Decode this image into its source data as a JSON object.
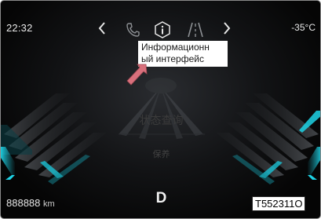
{
  "status_bar": {
    "time": "22:32",
    "temperature_value": "-35",
    "temperature_unit": "°C"
  },
  "nav": {
    "prev_icon": "chevron-left-icon",
    "next_icon": "chevron-right-icon",
    "icons": [
      "phone-icon",
      "info-icon",
      "road-icon"
    ]
  },
  "tooltip": {
    "text": "Информационн\nый интерфейс"
  },
  "menu": {
    "item_1": "状态查询",
    "item_2": "保养"
  },
  "odometer": {
    "value": "888888",
    "unit": "km"
  },
  "gear": "D",
  "figure_code": "T552311O",
  "colors": {
    "accent_cyan": "#35c6d8",
    "pointer": "#d9707c"
  }
}
